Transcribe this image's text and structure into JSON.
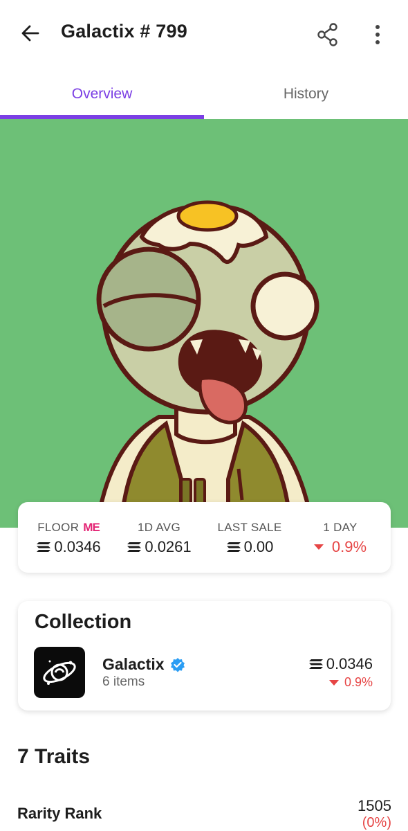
{
  "header": {
    "title": "Galactix # 799",
    "back_icon": "arrow-left-icon",
    "share_icon": "share-icon",
    "more_icon": "more-vertical-icon"
  },
  "tabs": [
    {
      "label": "Overview",
      "active": true
    },
    {
      "label": "History",
      "active": false
    }
  ],
  "colors": {
    "accent": "#7b3fe4",
    "negative": "#e64545",
    "art_background": "#6dc077",
    "magic_eden": "#e42575"
  },
  "stats": {
    "floor": {
      "label": "FLOOR",
      "value": "0.0346",
      "source_logo": "magic-eden-icon",
      "source_text": "ME"
    },
    "avg_1d": {
      "label": "1D AVG",
      "value": "0.0261"
    },
    "last_sale": {
      "label": "LAST SALE",
      "value": "0.00"
    },
    "change_1d": {
      "label": "1 DAY",
      "value": "0.9%",
      "direction": "down"
    }
  },
  "collection": {
    "heading": "Collection",
    "name": "Galactix",
    "verified_icon": "verified-badge-icon",
    "items": "6 items",
    "floor": "0.0346",
    "change": "0.9%",
    "change_direction": "down"
  },
  "traits": {
    "heading": "7 Traits",
    "rarity_label": "Rarity Rank",
    "rarity_value": "1505",
    "rarity_pct": "(0%)"
  }
}
